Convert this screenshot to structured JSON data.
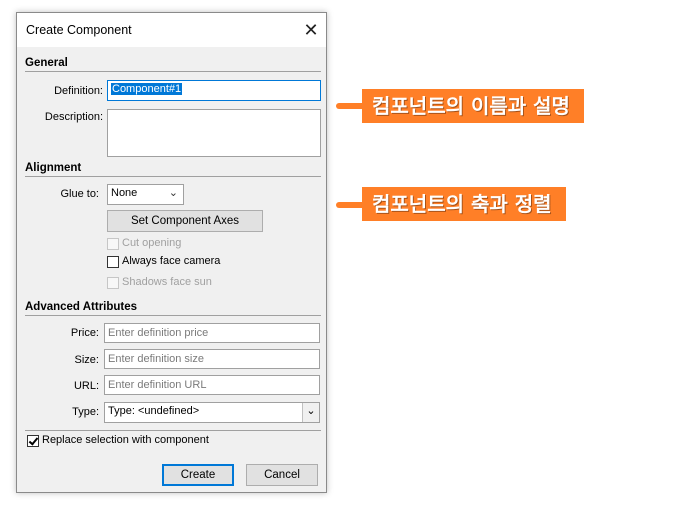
{
  "dialog": {
    "title": "Create Component",
    "close_glyph": "✕"
  },
  "general": {
    "heading": "General",
    "definition_label": "Definition:",
    "definition_value": "Component#1",
    "description_label": "Description:",
    "description_value": ""
  },
  "alignment": {
    "heading": "Alignment",
    "glue_label": "Glue to:",
    "glue_value": "None",
    "set_axes_label": "Set Component Axes",
    "cut_opening_label": "Cut opening",
    "face_camera_label": "Always face camera",
    "shadows_label": "Shadows face sun"
  },
  "advanced": {
    "heading": "Advanced Attributes",
    "price_label": "Price:",
    "price_placeholder": "Enter definition price",
    "size_label": "Size:",
    "size_placeholder": "Enter definition size",
    "url_label": "URL:",
    "url_placeholder": "Enter definition URL",
    "type_label": "Type:",
    "type_value": "Type: <undefined>"
  },
  "footer": {
    "replace_label": "Replace selection with component",
    "create_label": "Create",
    "cancel_label": "Cancel"
  },
  "annotations": {
    "callout1": "컴포넌트의 이름과 설명",
    "callout2": "컴포넌트의 축과 정렬"
  },
  "colors": {
    "accent": "#ff7f27",
    "selection": "#0078d7",
    "focus_border": "#0078d7"
  }
}
